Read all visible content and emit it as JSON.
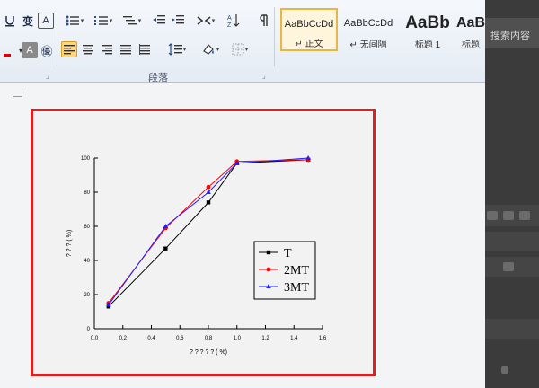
{
  "ribbon": {
    "paragraph_group_label": "段落",
    "styles": [
      {
        "sample": "AaBbCcDd",
        "name": "正文",
        "active": true
      },
      {
        "sample": "AaBbCcDd",
        "name": "无间隔",
        "active": false
      },
      {
        "sample": "AaBb",
        "name": "标题 1",
        "active": false
      },
      {
        "sample": "AaB",
        "name": "标题",
        "active": false
      }
    ],
    "font_buttons": {
      "a_box": "A",
      "yin": "变",
      "a_box2": "A",
      "circle": "㊝"
    }
  },
  "side_panel": {
    "search_label": "搜索内容"
  },
  "chart_data": {
    "type": "line",
    "xlabel": "? ? ? ? ? ( %)",
    "ylabel": "? ? ? ( %)",
    "xlim": [
      0.0,
      1.6
    ],
    "ylim": [
      0,
      100
    ],
    "xticks": [
      "0.0",
      "0.2",
      "0.4",
      "0.6",
      "0.8",
      "1.0",
      "1.2",
      "1.4",
      "1.6"
    ],
    "yticks": [
      "0",
      "20",
      "40",
      "60",
      "80",
      "100"
    ],
    "legend_position": "lower-right",
    "series": [
      {
        "name": "T",
        "color": "#000000",
        "marker": "square",
        "x": [
          0.1,
          0.5,
          0.8,
          1.0,
          1.5
        ],
        "y": [
          13,
          47,
          74,
          97,
          99
        ]
      },
      {
        "name": "2MT",
        "color": "#ff0000",
        "marker": "circle",
        "x": [
          0.1,
          0.5,
          0.8,
          1.0,
          1.5
        ],
        "y": [
          15,
          59,
          83,
          98,
          99
        ]
      },
      {
        "name": "3MT",
        "color": "#1f1fff",
        "marker": "triangle",
        "x": [
          0.1,
          0.5,
          0.8,
          1.0,
          1.5
        ],
        "y": [
          14,
          60,
          80,
          97,
          100
        ]
      }
    ]
  }
}
